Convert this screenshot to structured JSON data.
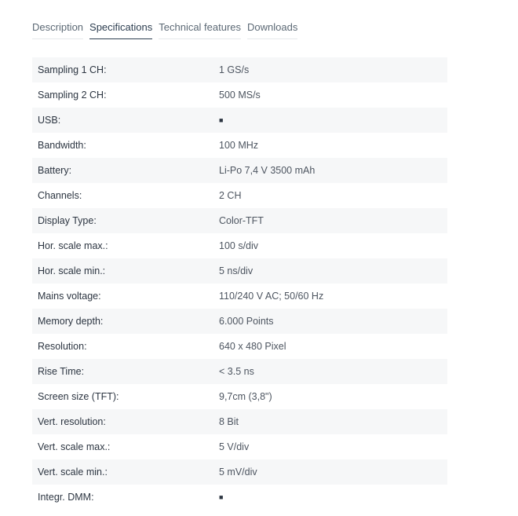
{
  "tabs": [
    {
      "label": "Description",
      "active": false
    },
    {
      "label": "Specifications",
      "active": true
    },
    {
      "label": "Technical features",
      "active": false
    },
    {
      "label": "Downloads",
      "active": false
    }
  ],
  "specs": [
    {
      "label": "Sampling 1 CH:",
      "value": "1 GS/s"
    },
    {
      "label": "Sampling 2 CH:",
      "value": "500 MS/s"
    },
    {
      "label": "USB:",
      "value": "■",
      "icon": "check-square-icon"
    },
    {
      "label": "Bandwidth:",
      "value": "100 MHz"
    },
    {
      "label": "Battery:",
      "value": "Li-Po 7,4 V 3500 mAh"
    },
    {
      "label": "Channels:",
      "value": "2 CH"
    },
    {
      "label": "Display Type:",
      "value": "Color-TFT"
    },
    {
      "label": "Hor. scale max.:",
      "value": "100 s/div"
    },
    {
      "label": "Hor. scale min.:",
      "value": "5 ns/div"
    },
    {
      "label": "Mains voltage:",
      "value": "110/240 V AC; 50/60 Hz"
    },
    {
      "label": "Memory depth:",
      "value": "6.000 Points"
    },
    {
      "label": "Resolution:",
      "value": "640 x 480 Pixel"
    },
    {
      "label": "Rise Time:",
      "value": "< 3.5 ns"
    },
    {
      "label": "Screen size (TFT):",
      "value": "9,7cm (3,8\")"
    },
    {
      "label": "Vert. resolution:",
      "value": "8 Bit"
    },
    {
      "label": "Vert. scale max.:",
      "value": "5 V/div"
    },
    {
      "label": "Vert. scale min.:",
      "value": "5 mV/div"
    },
    {
      "label": "Integr. DMM:",
      "value": "■",
      "icon": "check-square-icon"
    }
  ]
}
